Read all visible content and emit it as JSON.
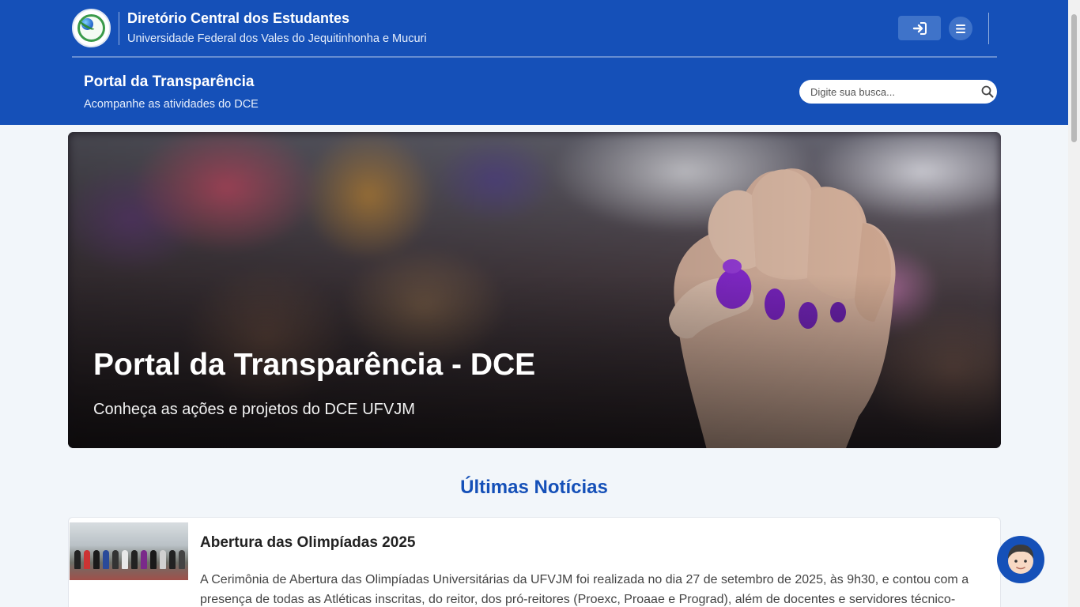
{
  "header": {
    "org_title": "Diretório Central dos Estudantes",
    "org_subtitle": "Universidade Federal dos Vales do Jequitinhonha e Mucuri",
    "login_icon": "sign-in-icon",
    "menu_icon": "bars-icon"
  },
  "portal": {
    "title": "Portal da Transparência",
    "subtitle": "Acompanhe as atividades do DCE"
  },
  "search": {
    "placeholder": "Digite sua busca...",
    "icon": "search-icon"
  },
  "hero": {
    "title": "Portal da Transparência - DCE",
    "subtitle": "Conheça as ações e projetos do DCE UFVJM"
  },
  "news": {
    "section_title": "Últimas Notícias",
    "items": [
      {
        "title": "Abertura das Olimpíadas 2025",
        "text": "A Cerimônia de Abertura das Olimpíadas Universitárias da UFVJM foi realizada no dia 27 de setembro de 2025, às 9h30, e contou com a presença de todas as Atléticas inscritas, do reitor, dos pró-reitores (Proexc, Proaae e Prograd), além de docentes e servidores técnico-"
      }
    ]
  },
  "colors": {
    "brand": "#1550b8",
    "page_bg": "#f2f6fa",
    "accent_nails": "#8a2bd6"
  }
}
